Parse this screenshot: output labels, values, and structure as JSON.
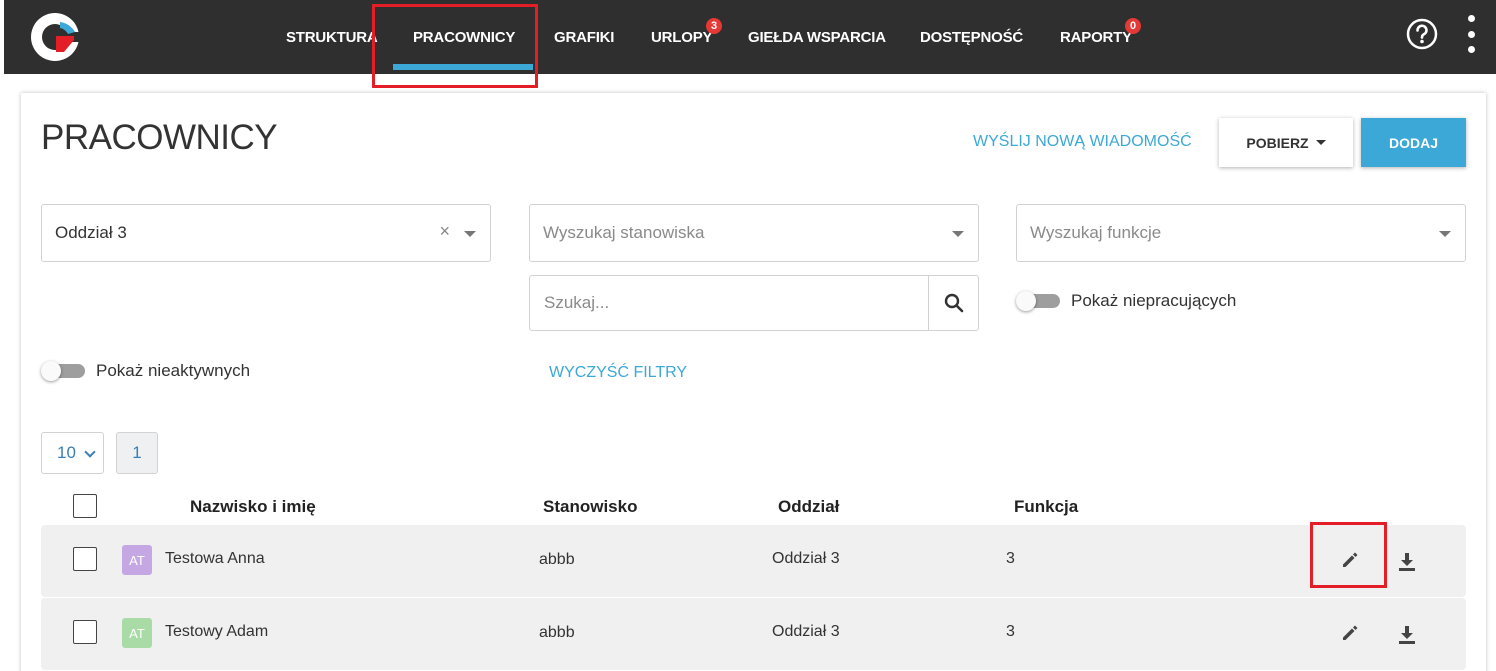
{
  "nav": {
    "items": [
      {
        "label": "STRUKTURA"
      },
      {
        "label": "PRACOWNICY"
      },
      {
        "label": "GRAFIKI"
      },
      {
        "label": "URLOPY",
        "badge": "3"
      },
      {
        "label": "GIEŁDA WSPARCIA"
      },
      {
        "label": "DOSTĘPNOŚĆ"
      },
      {
        "label": "RAPORTY",
        "badge": "0"
      }
    ],
    "active": "PRACOWNICY",
    "icons": [
      "help-circle-icon",
      "kebab-menu-icon"
    ]
  },
  "page": {
    "title": "PRACOWNICY",
    "send_message": "WYŚLIJ NOWĄ WIADOMOŚĆ",
    "download_label": "POBIERZ",
    "add_label": "DODAJ"
  },
  "filters": {
    "branch_value": "Oddział 3",
    "position_placeholder": "Wyszukaj stanowiska",
    "function_placeholder": "Wyszukaj funkcje",
    "search_placeholder": "Szukaj...",
    "show_not_working": "Pokaż niepracujących",
    "show_inactive": "Pokaż nieaktywnych",
    "clear": "WYCZYŚĆ FILTRY"
  },
  "pager": {
    "page_size": "10",
    "current_page": "1"
  },
  "table": {
    "headers": [
      "Nazwisko i imię",
      "Stanowisko",
      "Oddział",
      "Funkcja"
    ],
    "rows": [
      {
        "initials": "AT",
        "name": "Testowa Anna",
        "position": "abbb",
        "branch": "Oddział 3",
        "function": "3",
        "avatar_color": "#c5a8e3"
      },
      {
        "initials": "AT",
        "name": "Testowy Adam",
        "position": "abbb",
        "branch": "Oddział 3",
        "function": "3",
        "avatar_color": "#a9dba6"
      }
    ]
  },
  "colors": {
    "topbar": "#2f2f2f",
    "accent": "#3ca8d8",
    "highlight": "#e41e26",
    "badge": "#e53935"
  }
}
